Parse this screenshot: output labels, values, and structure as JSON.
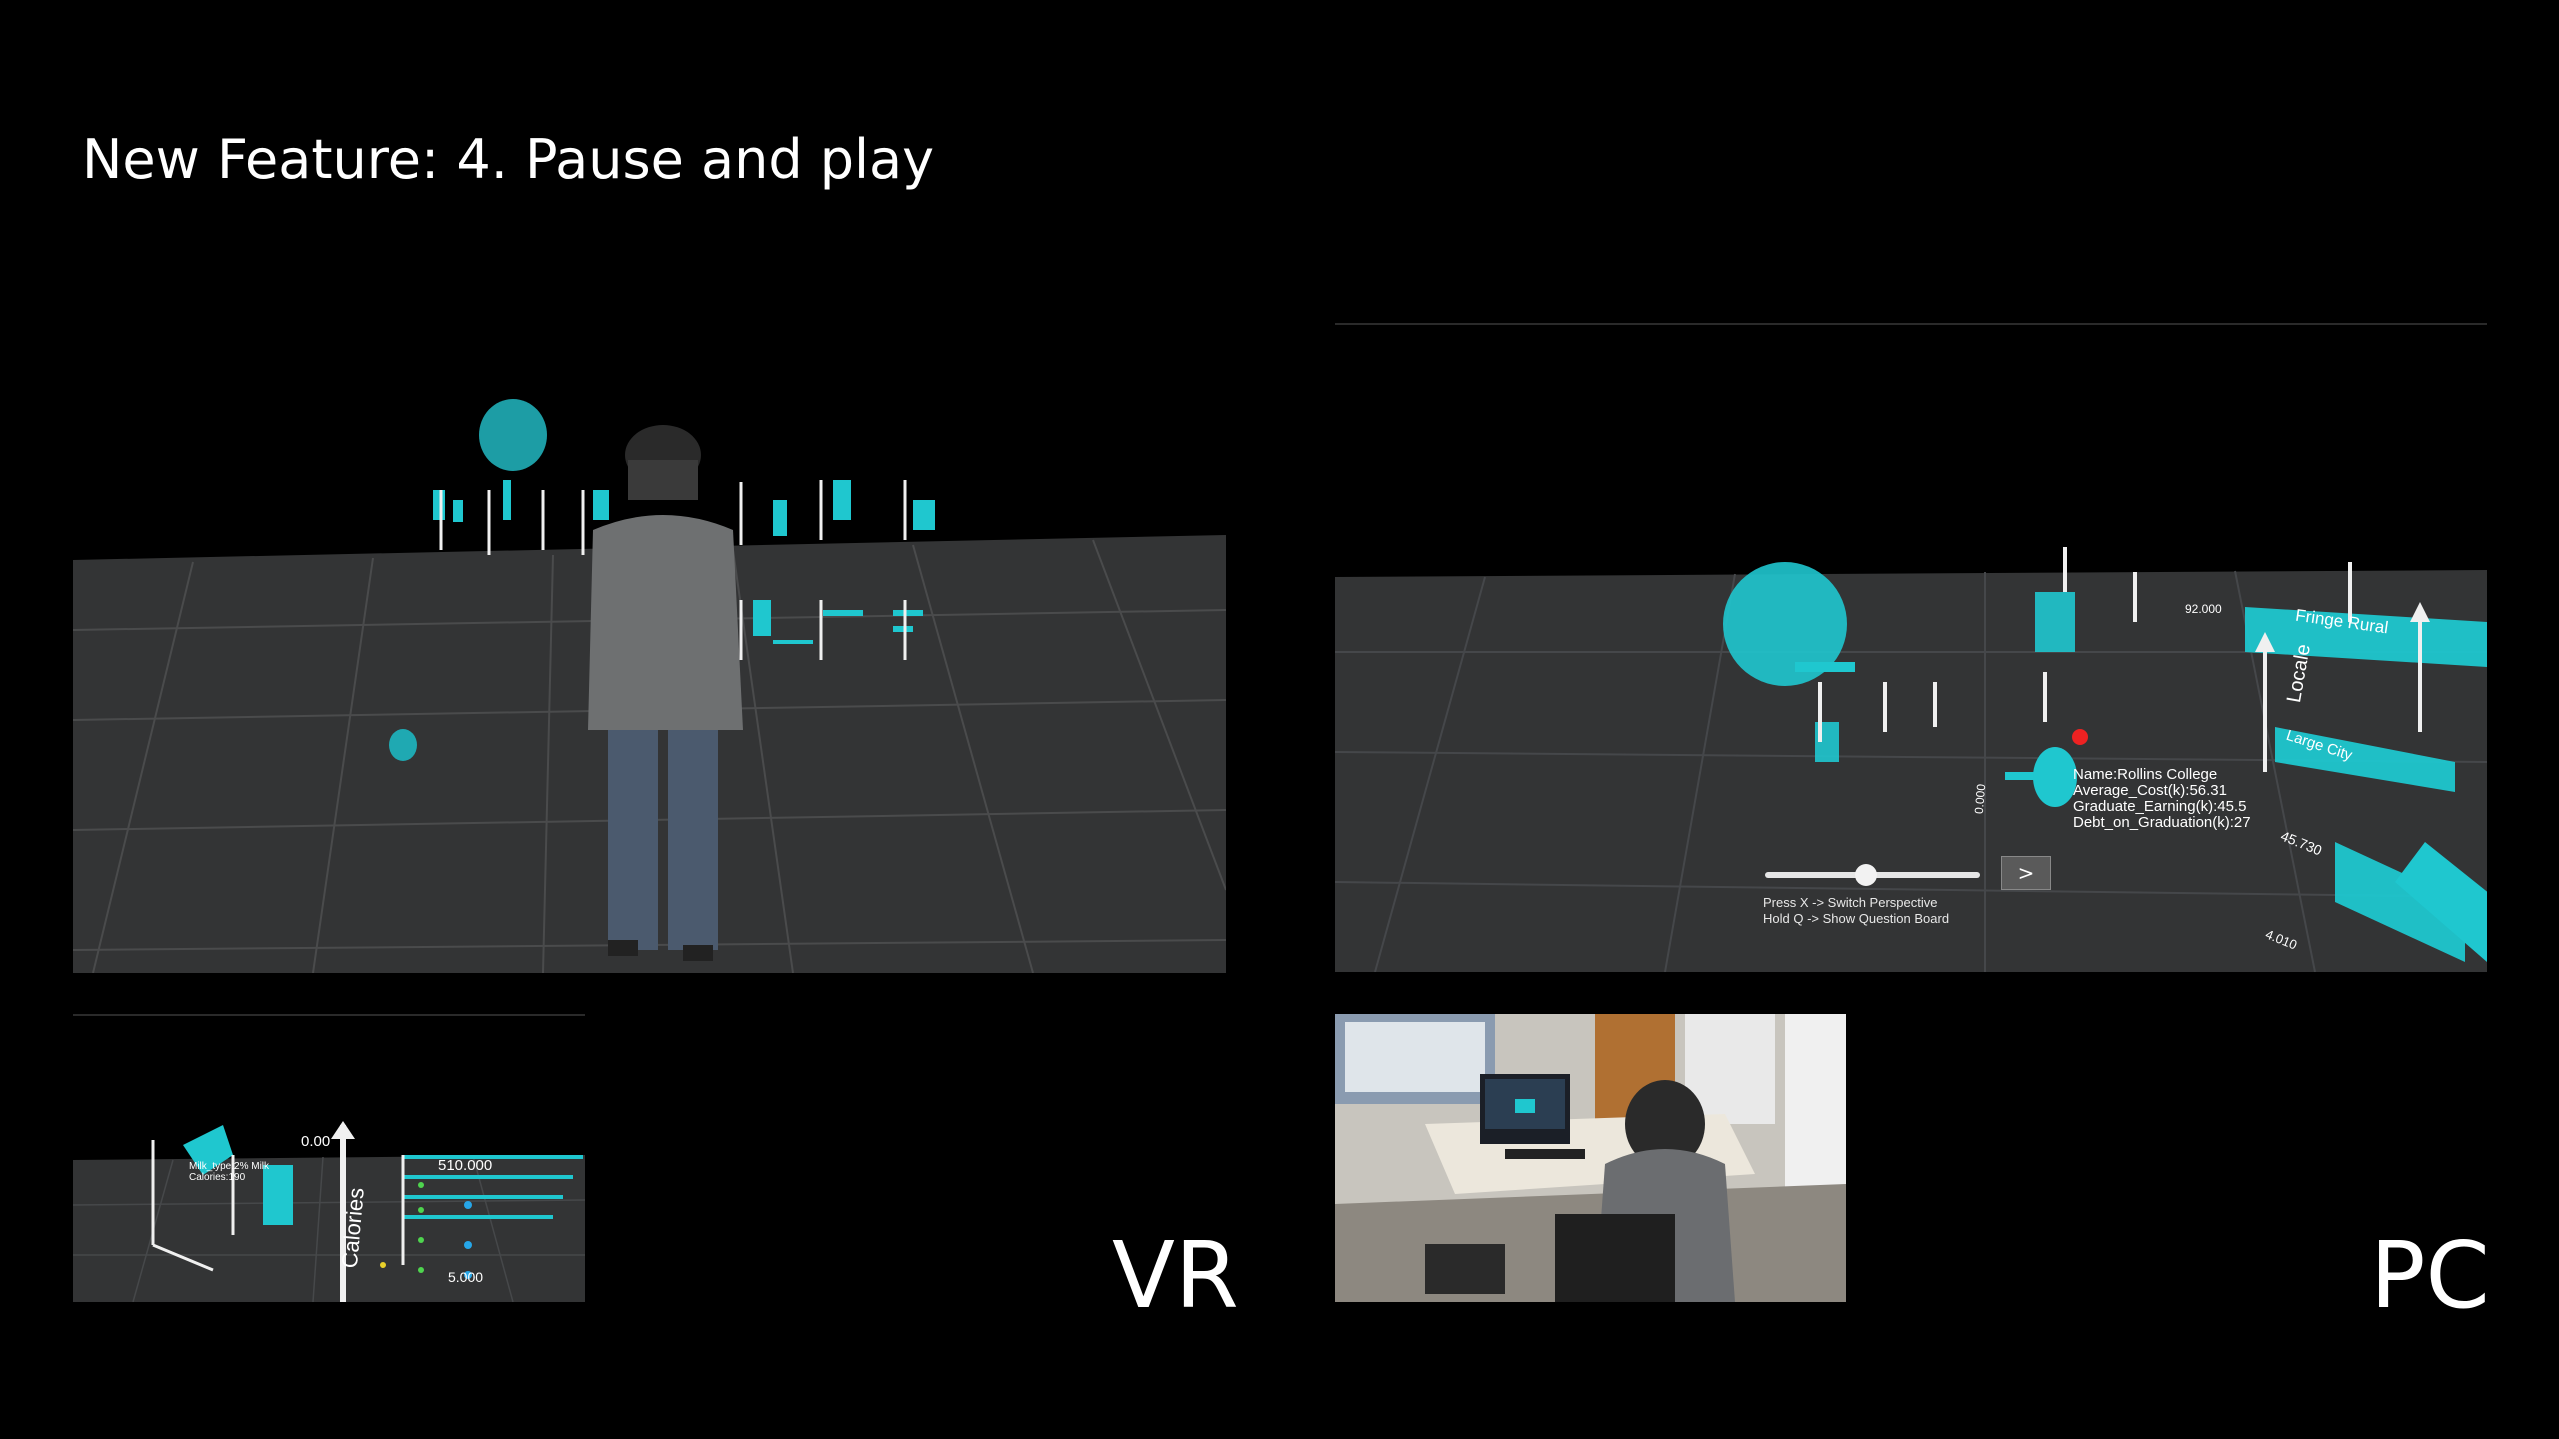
{
  "title": "New Feature: 4. Pause and play",
  "labels": {
    "vr": "VR",
    "pc": "PC"
  },
  "pc_view": {
    "hud_line1": "Press X -> Switch Perspective",
    "hud_line2": "Hold Q -> Show Question Board",
    "play_button": ">",
    "slider_value": 0.47,
    "tooltip": {
      "name": "Name:Rollins College",
      "cost": "Average_Cost(k):56.31",
      "earning": "Graduate_Earning(k):45.5",
      "debt": "Debt_on_Graduation(k):27"
    },
    "axis_labels": {
      "fringe_rural": "Fringe Rural",
      "large_city": "Large City",
      "locale": "Locale",
      "v92": "92.000",
      "v45": "45.730",
      "v4": "4.010",
      "v0": "0.000"
    }
  },
  "vr_inset": {
    "milk": "Milk_type:2% Milk",
    "cal": "Calories:190",
    "v0": "0.00",
    "v510": "510.000",
    "v5": "5.000",
    "calories": "Calories"
  },
  "colors": {
    "background": "#000000",
    "floor": "#333435",
    "data": "#1fc7cf",
    "grid": "#4a4b4c"
  }
}
